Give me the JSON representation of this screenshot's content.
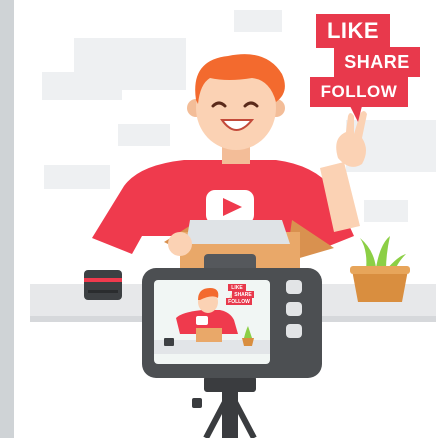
{
  "badges": {
    "like": "LIKE",
    "share": "SHARE",
    "follow": "FOLLOW"
  },
  "mini_badges": {
    "like": "LIKE",
    "share": "SHARE",
    "follow": "FOLLOW"
  },
  "colors": {
    "accent_red": "#e8394c",
    "shirt_red": "#ef3a4d",
    "hair": "#f36a2e",
    "skin": "#fbd2b4",
    "box": "#e9a869",
    "camera": "#4c4f52",
    "screen_bg": "#f1f6f4",
    "plant": "#8ccf45",
    "pot": "#d98e3f",
    "ghost_boxes": "#eef0f2"
  },
  "icons": [
    "play-icon",
    "camera-icon",
    "lens-icon",
    "plant-icon",
    "tripod-icon"
  ]
}
